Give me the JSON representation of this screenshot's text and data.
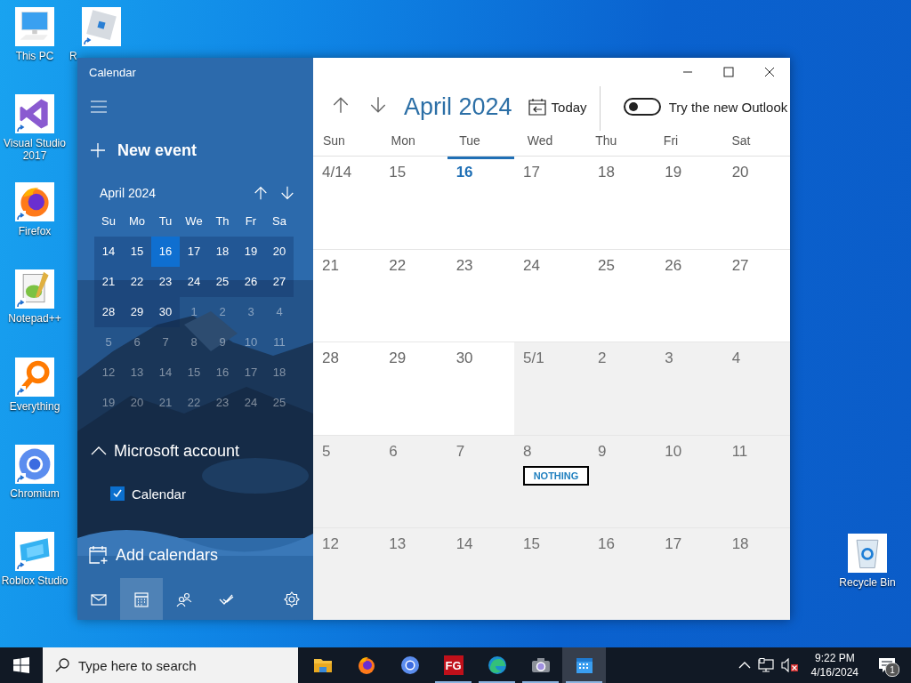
{
  "desktop_icons": [
    {
      "label": "This PC",
      "kind": "pc",
      "shortcut": false
    },
    {
      "label": "R",
      "kind": "roblox",
      "shortcut": true
    },
    {
      "label": "Visual Studio 2017",
      "kind": "vs",
      "shortcut": true
    },
    {
      "label": "Firefox",
      "kind": "firefox",
      "shortcut": true
    },
    {
      "label": "Notepad++",
      "kind": "notepad",
      "shortcut": true
    },
    {
      "label": "Everything",
      "kind": "everything",
      "shortcut": true
    },
    {
      "label": "Chromium",
      "kind": "chromium",
      "shortcut": true
    },
    {
      "label": "Roblox Studio",
      "kind": "studio",
      "shortcut": true
    },
    {
      "label": "Recycle Bin",
      "kind": "recycle",
      "shortcut": false
    }
  ],
  "window": {
    "title": "Calendar",
    "sidebar": {
      "new_event": "New event",
      "mini_calendar": {
        "title": "April 2024",
        "weekdays": [
          "Su",
          "Mo",
          "Tu",
          "We",
          "Th",
          "Fr",
          "Sa"
        ],
        "days": [
          {
            "day": "14",
            "in_month": true,
            "selected": false
          },
          {
            "day": "15",
            "in_month": true,
            "selected": false
          },
          {
            "day": "16",
            "in_month": true,
            "selected": true
          },
          {
            "day": "17",
            "in_month": true,
            "selected": false
          },
          {
            "day": "18",
            "in_month": true,
            "selected": false
          },
          {
            "day": "19",
            "in_month": true,
            "selected": false
          },
          {
            "day": "20",
            "in_month": true,
            "selected": false
          },
          {
            "day": "21",
            "in_month": true,
            "selected": false
          },
          {
            "day": "22",
            "in_month": true,
            "selected": false
          },
          {
            "day": "23",
            "in_month": true,
            "selected": false
          },
          {
            "day": "24",
            "in_month": true,
            "selected": false
          },
          {
            "day": "25",
            "in_month": true,
            "selected": false
          },
          {
            "day": "26",
            "in_month": true,
            "selected": false
          },
          {
            "day": "27",
            "in_month": true,
            "selected": false
          },
          {
            "day": "28",
            "in_month": true,
            "selected": false
          },
          {
            "day": "29",
            "in_month": true,
            "selected": false
          },
          {
            "day": "30",
            "in_month": true,
            "selected": false
          },
          {
            "day": "1",
            "in_month": false,
            "selected": false
          },
          {
            "day": "2",
            "in_month": false,
            "selected": false
          },
          {
            "day": "3",
            "in_month": false,
            "selected": false
          },
          {
            "day": "4",
            "in_month": false,
            "selected": false
          },
          {
            "day": "5",
            "in_month": false,
            "selected": false
          },
          {
            "day": "6",
            "in_month": false,
            "selected": false
          },
          {
            "day": "7",
            "in_month": false,
            "selected": false
          },
          {
            "day": "8",
            "in_month": false,
            "selected": false
          },
          {
            "day": "9",
            "in_month": false,
            "selected": false
          },
          {
            "day": "10",
            "in_month": false,
            "selected": false
          },
          {
            "day": "11",
            "in_month": false,
            "selected": false
          },
          {
            "day": "12",
            "in_month": false,
            "selected": false
          },
          {
            "day": "13",
            "in_month": false,
            "selected": false
          },
          {
            "day": "14",
            "in_month": false,
            "selected": false
          },
          {
            "day": "15",
            "in_month": false,
            "selected": false
          },
          {
            "day": "16",
            "in_month": false,
            "selected": false
          },
          {
            "day": "17",
            "in_month": false,
            "selected": false
          },
          {
            "day": "18",
            "in_month": false,
            "selected": false
          },
          {
            "day": "19",
            "in_month": false,
            "selected": false
          },
          {
            "day": "20",
            "in_month": false,
            "selected": false
          },
          {
            "day": "21",
            "in_month": false,
            "selected": false
          },
          {
            "day": "22",
            "in_month": false,
            "selected": false
          },
          {
            "day": "23",
            "in_month": false,
            "selected": false
          },
          {
            "day": "24",
            "in_month": false,
            "selected": false
          },
          {
            "day": "25",
            "in_month": false,
            "selected": false
          }
        ]
      },
      "account": {
        "name": "Microsoft account",
        "expanded": true,
        "calendars": [
          {
            "name": "Calendar",
            "checked": true
          }
        ]
      },
      "add_calendars": "Add calendars",
      "nav": [
        {
          "kind": "mail",
          "selected": false
        },
        {
          "kind": "calendar",
          "selected": true
        },
        {
          "kind": "people",
          "selected": false
        },
        {
          "kind": "todo",
          "selected": false
        },
        {
          "kind": "settings",
          "selected": false
        }
      ]
    },
    "main": {
      "title": "April 2024",
      "today_button": "Today",
      "outlook_toggle": {
        "label": "Try the new Outlook",
        "on": false
      },
      "weekdays": [
        "Sun",
        "Mon",
        "Tue",
        "Wed",
        "Thu",
        "Fri",
        "Sat"
      ],
      "cells": [
        {
          "date": "4/14",
          "in_month": true,
          "today": false
        },
        {
          "date": "15",
          "in_month": true,
          "today": false
        },
        {
          "date": "16",
          "in_month": true,
          "today": true
        },
        {
          "date": "17",
          "in_month": true,
          "today": false
        },
        {
          "date": "18",
          "in_month": true,
          "today": false
        },
        {
          "date": "19",
          "in_month": true,
          "today": false
        },
        {
          "date": "20",
          "in_month": true,
          "today": false
        },
        {
          "date": "21",
          "in_month": true,
          "today": false
        },
        {
          "date": "22",
          "in_month": true,
          "today": false
        },
        {
          "date": "23",
          "in_month": true,
          "today": false
        },
        {
          "date": "24",
          "in_month": true,
          "today": false
        },
        {
          "date": "25",
          "in_month": true,
          "today": false
        },
        {
          "date": "26",
          "in_month": true,
          "today": false
        },
        {
          "date": "27",
          "in_month": true,
          "today": false
        },
        {
          "date": "28",
          "in_month": true,
          "today": false
        },
        {
          "date": "29",
          "in_month": true,
          "today": false
        },
        {
          "date": "30",
          "in_month": true,
          "today": false
        },
        {
          "date": "5/1",
          "in_month": false,
          "today": false
        },
        {
          "date": "2",
          "in_month": false,
          "today": false
        },
        {
          "date": "3",
          "in_month": false,
          "today": false
        },
        {
          "date": "4",
          "in_month": false,
          "today": false
        },
        {
          "date": "5",
          "in_month": false,
          "today": false
        },
        {
          "date": "6",
          "in_month": false,
          "today": false
        },
        {
          "date": "7",
          "in_month": false,
          "today": false
        },
        {
          "date": "8",
          "in_month": false,
          "today": false,
          "events": [
            {
              "title": "NOTHING"
            }
          ]
        },
        {
          "date": "9",
          "in_month": false,
          "today": false
        },
        {
          "date": "10",
          "in_month": false,
          "today": false
        },
        {
          "date": "11",
          "in_month": false,
          "today": false
        },
        {
          "date": "12",
          "in_month": false,
          "today": false
        },
        {
          "date": "13",
          "in_month": false,
          "today": false
        },
        {
          "date": "14",
          "in_month": false,
          "today": false
        },
        {
          "date": "15",
          "in_month": false,
          "today": false
        },
        {
          "date": "16",
          "in_month": false,
          "today": false
        },
        {
          "date": "17",
          "in_month": false,
          "today": false
        },
        {
          "date": "18",
          "in_month": false,
          "today": false
        }
      ]
    }
  },
  "taskbar": {
    "search": {
      "placeholder": "Type here to search"
    },
    "apps": [
      {
        "kind": "explorer",
        "running": false,
        "selected": false
      },
      {
        "kind": "firefox",
        "running": false,
        "selected": false
      },
      {
        "kind": "chromium",
        "running": false,
        "selected": false
      },
      {
        "kind": "fg",
        "label": "FG",
        "running": true,
        "selected": false
      },
      {
        "kind": "edge",
        "running": true,
        "selected": false
      },
      {
        "kind": "camera",
        "running": true,
        "selected": false
      },
      {
        "kind": "calendar",
        "running": true,
        "selected": true
      }
    ],
    "time": "9:22 PM",
    "date": "4/16/2024",
    "notifications": "1"
  }
}
